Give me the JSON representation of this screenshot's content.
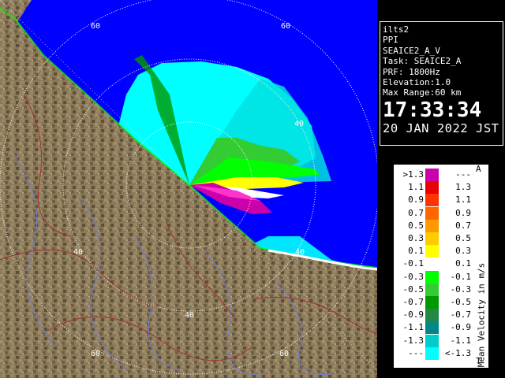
{
  "info": {
    "station": "ilts2",
    "product": "PPI",
    "volume": "SEAICE2_A_V",
    "task": "Task: SEAICE2_A",
    "prf": "PRF: 1800Hz",
    "elevation": "Elevation:1.0",
    "max_range": "Max Range:60 km",
    "time": "17:33:34",
    "date": "20 JAN 2022 JST"
  },
  "range_rings": {
    "labels": [
      "60",
      "60",
      "40",
      "40",
      "40",
      "40",
      "60",
      "60"
    ]
  },
  "legend": {
    "unit": "Mean Velocity in m/s",
    "top_marker": "A",
    "bottom_marker": "T",
    "rows": [
      {
        "low": ">1.3",
        "high": "---",
        "color": "#cc00aa"
      },
      {
        "low": "1.1",
        "high": "1.3",
        "color": "#e60000"
      },
      {
        "low": "0.9",
        "high": "1.1",
        "color": "#ff3300"
      },
      {
        "low": "0.7",
        "high": "0.9",
        "color": "#ff6600"
      },
      {
        "low": "0.5",
        "high": "0.7",
        "color": "#ff9900"
      },
      {
        "low": "0.3",
        "high": "0.5",
        "color": "#ffcc00"
      },
      {
        "low": "0.1",
        "high": "0.3",
        "color": "#ffff00"
      },
      {
        "low": "-0.1",
        "high": "0.1",
        "color": "#ffffff"
      },
      {
        "low": "-0.3",
        "high": "-0.1",
        "color": "#00ff00"
      },
      {
        "low": "-0.5",
        "high": "-0.3",
        "color": "#33cc33"
      },
      {
        "low": "-0.7",
        "high": "-0.5",
        "color": "#009900"
      },
      {
        "low": "-0.9",
        "high": "-0.7",
        "color": "#228844"
      },
      {
        "low": "-1.1",
        "high": "-0.9",
        "color": "#008888"
      },
      {
        "low": "-1.3",
        "high": "-1.1",
        "color": "#00cccc"
      },
      {
        "low": "---",
        "high": "<-1.3",
        "color": "#00ffff"
      }
    ]
  },
  "colors": {
    "sea": "#0000ff",
    "land": "#8b7a5a",
    "rings": "#ffffff"
  }
}
